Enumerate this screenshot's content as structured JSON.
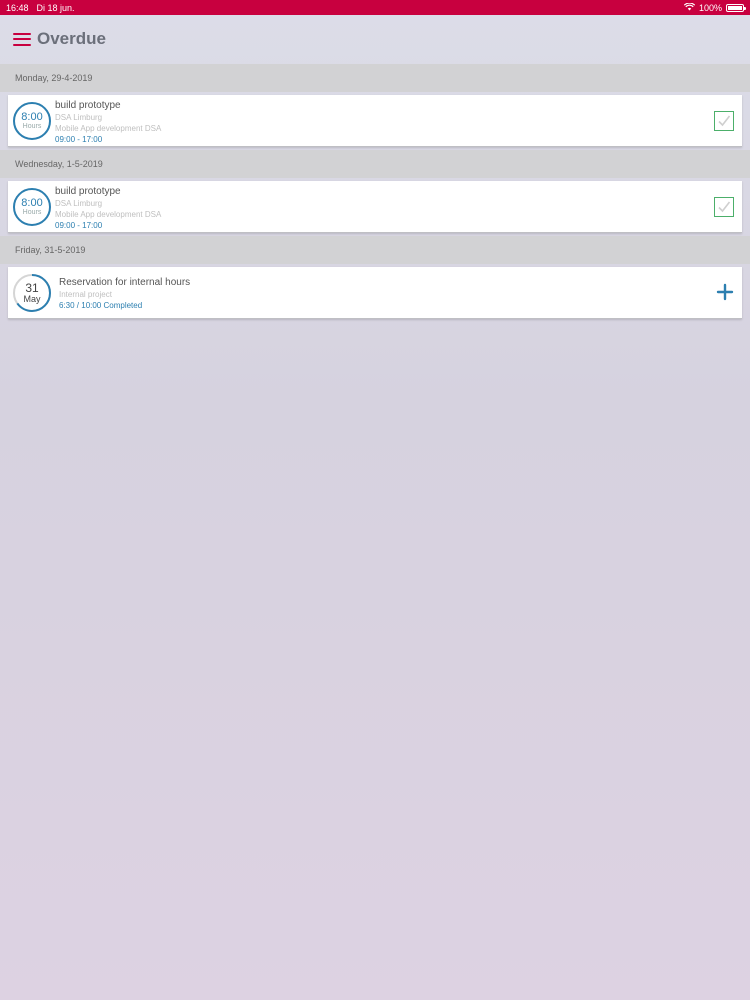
{
  "status_bar": {
    "time": "16:48",
    "date": "Di 18 jun.",
    "battery": "100%"
  },
  "header": {
    "title": "Overdue"
  },
  "sections": [
    {
      "date": "Monday, 29-4-2019",
      "item": {
        "ring_value": "8:00",
        "ring_unit": "Hours",
        "title": "build prototype",
        "sub1": "DSA Limburg",
        "sub2": "Mobile App development DSA",
        "time": "09:00 - 17:00",
        "action": "check-icon"
      }
    },
    {
      "date": "Wednesday, 1-5-2019",
      "item": {
        "ring_value": "8:00",
        "ring_unit": "Hours",
        "title": "build prototype",
        "sub1": "DSA Limburg",
        "sub2": "Mobile App development DSA",
        "time": "09:00 - 17:00",
        "action": "check-icon"
      }
    },
    {
      "date": "Friday, 31-5-2019",
      "item": {
        "ring_value": "31",
        "ring_unit": "May",
        "title": "Reservation for internal hours",
        "sub1": "Internal project",
        "time": "6:30 / 10:00 Completed",
        "progress": 0.65,
        "action": "plus-icon"
      }
    }
  ],
  "colors": {
    "accent": "#c8003f",
    "blue": "#2c7fb0",
    "green": "#4caf6a"
  }
}
